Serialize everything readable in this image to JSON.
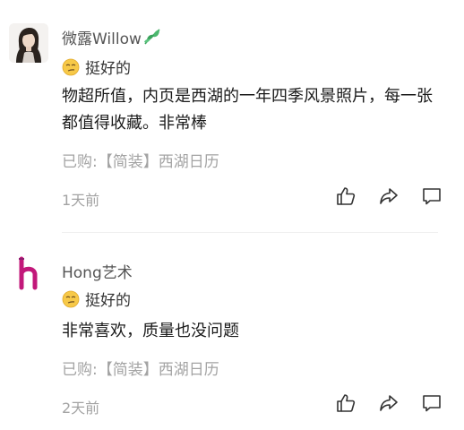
{
  "reviews": [
    {
      "username": "微露Willow",
      "rating_label": "挺好的",
      "content": "物超所值，内页是西湖的一年四季风景照片，每一张都值得收藏。非常棒",
      "purchase": "已购:【简装】西湖日历",
      "time": "1天前"
    },
    {
      "username": "Hong艺术",
      "rating_label": "挺好的",
      "content": "非常喜欢，质量也没问题",
      "purchase": "已购:【简装】西湖日历",
      "time": "2天前"
    }
  ],
  "icons": {
    "like": "thumbs-up-icon",
    "share": "share-icon",
    "comment": "comment-icon",
    "rating": "smirk-emoji-icon",
    "leaf": "leaf-icon"
  },
  "colors": {
    "secondary_text": "#a3a3a3",
    "hong_logo": "#c2187a",
    "leaf": "#3aa35c",
    "emoji": "#f7c948"
  }
}
